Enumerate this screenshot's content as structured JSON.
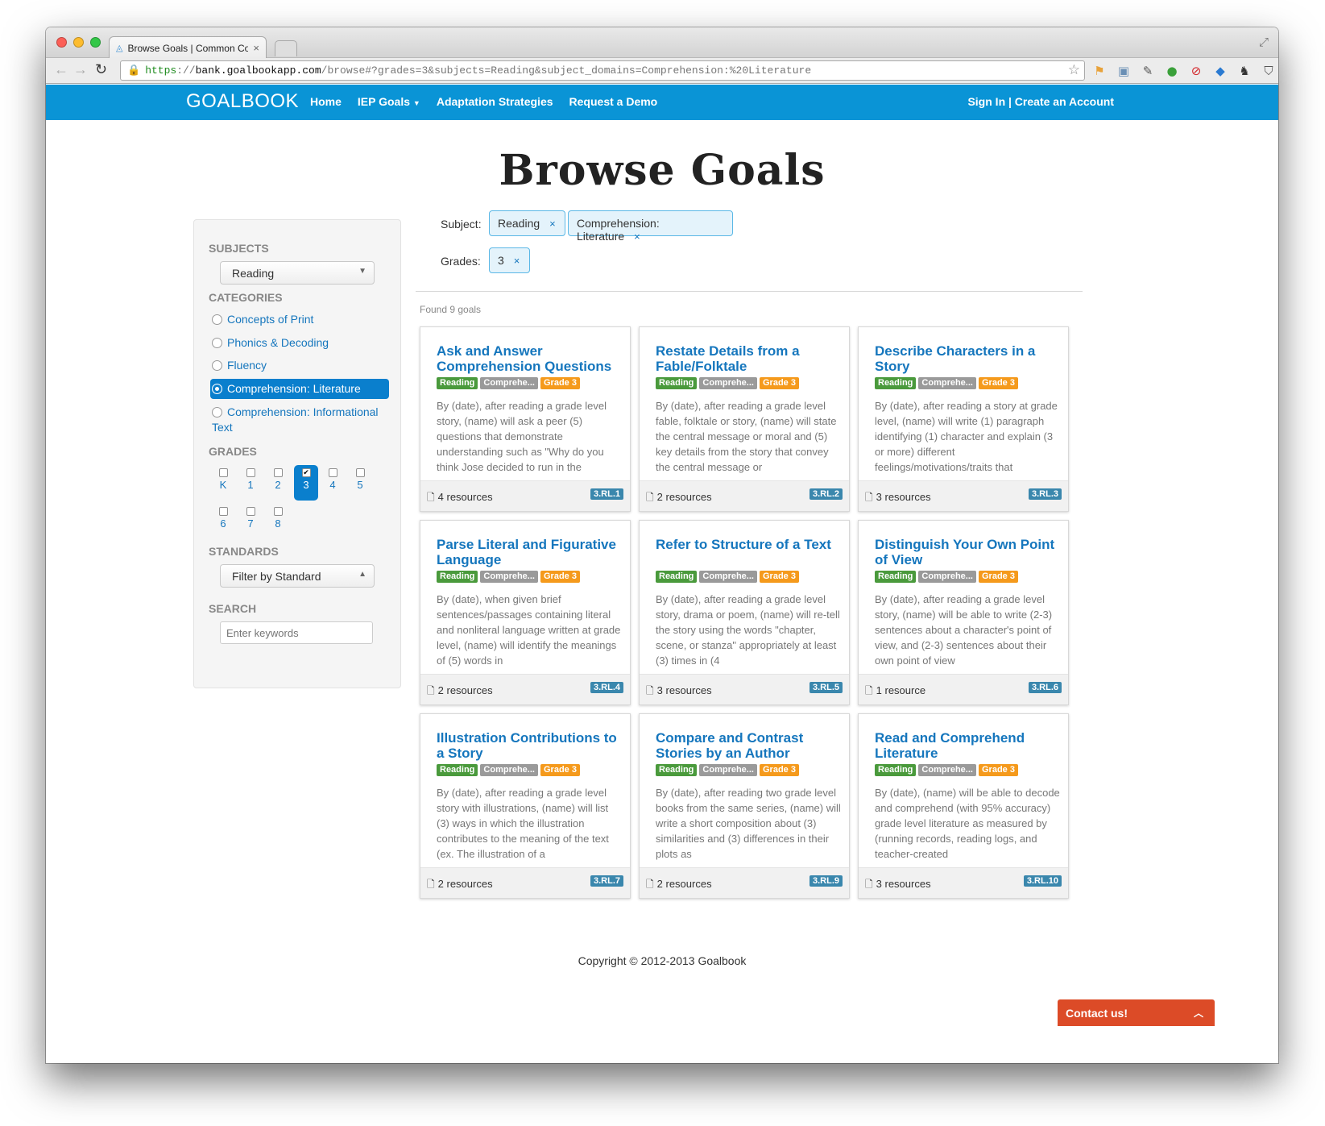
{
  "browser": {
    "tab_title": "Browse Goals | Common Cor",
    "tab_close": "×",
    "url_scheme": "https",
    "url_sep": "://",
    "url_host": "bank.goalbookapp.com",
    "url_path": "/browse#?grades=3&subjects=Reading&subject_domains=Comprehension:%20Literature"
  },
  "site": {
    "brand": "GOALBOOK",
    "nav": [
      "Home",
      "IEP Goals",
      "Adaptation Strategies",
      "Request a Demo"
    ],
    "signin": "Sign In | Create an Account"
  },
  "page_title": "Browse Goals",
  "sidebar": {
    "subjects_heading": "SUBJECTS",
    "subject_selected": "Reading",
    "categories_heading": "CATEGORIES",
    "categories": [
      {
        "label": "Concepts of Print",
        "selected": false
      },
      {
        "label": "Phonics & Decoding",
        "selected": false
      },
      {
        "label": "Fluency",
        "selected": false
      },
      {
        "label": "Comprehension: Literature",
        "selected": true
      },
      {
        "label": "Comprehension: Informational Text",
        "selected": false
      }
    ],
    "grades_heading": "GRADES",
    "grades": [
      "K",
      "1",
      "2",
      "3",
      "4",
      "5",
      "6",
      "7",
      "8"
    ],
    "grade_checked": "3",
    "standards_heading": "STANDARDS",
    "standards_placeholder": "Filter by Standard",
    "search_heading": "SEARCH",
    "search_placeholder": "Enter keywords"
  },
  "filters": {
    "subject_label": "Subject:",
    "grades_label": "Grades:",
    "subject_chips": [
      "Reading",
      "Comprehension: Literature"
    ],
    "grade_chips": [
      "3"
    ],
    "remove": "×"
  },
  "found": "Found 9 goals",
  "tags": {
    "subject": "Reading",
    "domain": "Comprehe...",
    "grade": "Grade 3"
  },
  "goals": [
    {
      "title": "Ask and Answer Comprehension Questions",
      "desc": "By (date), after reading a grade level story, (name) will ask a peer (5) questions that demonstrate understanding such as \"Why do you think Jose decided to run in the",
      "resources": "4 resources",
      "standard": "3.RL.1"
    },
    {
      "title": "Restate Details from a Fable/Folktale",
      "desc": "By (date), after reading a grade level fable, folktale or story, (name) will state the central message or moral and (5) key details from the story that convey the central message or",
      "resources": "2 resources",
      "standard": "3.RL.2"
    },
    {
      "title": "Describe Characters in a Story",
      "desc": "By (date), after reading a story at grade level, (name) will write (1) paragraph identifying (1) character and explain (3 or more) different feelings/motivations/traits that",
      "resources": "3 resources",
      "standard": "3.RL.3"
    },
    {
      "title": "Parse Literal and Figurative Language",
      "desc": "By (date), when given brief sentences/passages containing literal and nonliteral language written at grade level, (name) will identify the meanings of (5) words in",
      "resources": "2 resources",
      "standard": "3.RL.4"
    },
    {
      "title": "Refer to Structure of a Text",
      "desc": "By (date), after reading a grade level story, drama or poem, (name) will re-tell the story using the words \"chapter, scene, or stanza\" appropriately at least (3) times in (4",
      "resources": "3 resources",
      "standard": "3.RL.5"
    },
    {
      "title": "Distinguish Your Own Point of View",
      "desc": "By (date), after reading a grade level story, (name) will be able to write (2-3) sentences about a character's point of view, and (2-3) sentences about their own point of view",
      "resources": "1 resource",
      "standard": "3.RL.6"
    },
    {
      "title": "Illustration Contributions to a Story",
      "desc": "By (date), after reading a grade level story with illustrations, (name) will list (3) ways in which the illustration contributes to the meaning of the text (ex. The illustration of a",
      "resources": "2 resources",
      "standard": "3.RL.7"
    },
    {
      "title": "Compare and Contrast Stories by an Author",
      "desc": "By (date), after reading two grade level books from the same series, (name) will write a short composition about (3) similarities and (3) differences in their plots as",
      "resources": "2 resources",
      "standard": "3.RL.9"
    },
    {
      "title": "Read and Comprehend Literature",
      "desc": "By (date), (name) will be able to decode and comprehend (with 95% accuracy) grade level literature as measured by (running records, reading logs, and teacher-created",
      "resources": "3 resources",
      "standard": "3.RL.10"
    }
  ],
  "copyright": "Copyright © 2012-2013 Goalbook",
  "contact": "Contact us!",
  "icons": {
    "doc": "document-icon",
    "star": "bookmark-star-icon",
    "lock": "lock-icon"
  },
  "colors": {
    "navbar": "#0a94d6",
    "link": "#1576bd",
    "contact": "#dc4b27",
    "tag_subject": "#4a9a3c",
    "tag_domain": "#9a9a9a",
    "tag_grade": "#f59a1c",
    "standard": "#3a87ad"
  }
}
